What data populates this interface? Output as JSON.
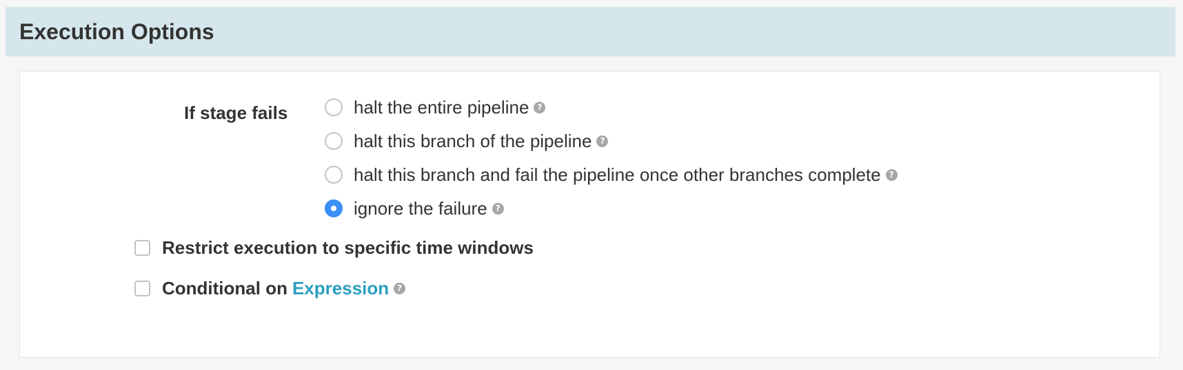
{
  "header": {
    "title": "Execution Options"
  },
  "stage_failure": {
    "label": "If stage fails",
    "options": [
      {
        "label": "halt the entire pipeline",
        "checked": false,
        "help_icon": "question-circle-icon"
      },
      {
        "label": "halt this branch of the pipeline",
        "checked": false,
        "help_icon": "question-circle-icon"
      },
      {
        "label": "halt this branch and fail the pipeline once other branches complete",
        "checked": false,
        "help_icon": "question-circle-icon"
      },
      {
        "label": "ignore the failure",
        "checked": true,
        "help_icon": "question-circle-icon"
      }
    ]
  },
  "restrict_execution": {
    "label": "Restrict execution to specific time windows",
    "checked": false
  },
  "conditional": {
    "label": "Conditional on",
    "link_label": "Expression",
    "checked": false,
    "help_icon": "question-circle-icon"
  },
  "help_icon_glyph": "?",
  "colors": {
    "header_bg": "#d5e7ec",
    "radio_selected": "#3a8ff6",
    "link": "#2a9fbf",
    "help_icon": "#a7a7a7"
  }
}
